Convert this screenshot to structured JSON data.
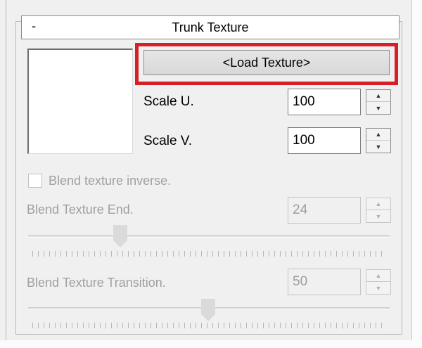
{
  "group": {
    "collapse_symbol": "-",
    "title": "Trunk Texture"
  },
  "load_texture": {
    "label": "<Load Texture>"
  },
  "scale_u": {
    "label": "Scale U.",
    "value": "100"
  },
  "scale_v": {
    "label": "Scale V.",
    "value": "100"
  },
  "blend_inverse": {
    "label": "Blend texture inverse.",
    "checked": false
  },
  "blend_end": {
    "label": "Blend Texture End.",
    "value": "24",
    "slider_fraction": 0.25
  },
  "blend_transition": {
    "label": "Blend Texture Transition.",
    "value": "50",
    "slider_fraction": 0.5
  },
  "spinner_icons": {
    "up": "▲",
    "down": "▼"
  },
  "colors": {
    "highlight": "#d81f26",
    "disabled_text": "#a0a0a0"
  }
}
